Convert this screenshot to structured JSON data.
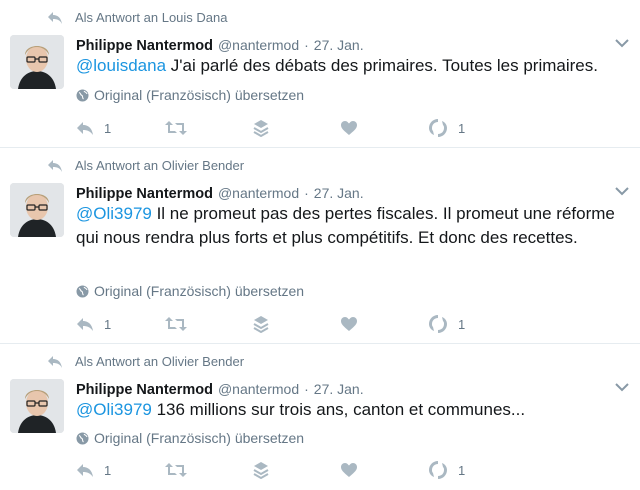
{
  "tweets": [
    {
      "context": "Als Antwort an Louis Dana",
      "fullname": "Philippe Nantermod",
      "username": "@nantermod",
      "separator": "·",
      "time": "27. Jan.",
      "mention": "@louisdana",
      "text": " J'ai parlé des débats des primaires. Toutes les primaires.",
      "translate": "Original (Französisch) übersetzen",
      "reply_count": "1",
      "sound_count": "1"
    },
    {
      "context": "Als Antwort an Olivier Bender",
      "fullname": "Philippe Nantermod",
      "username": "@nantermod",
      "separator": "·",
      "time": "27. Jan.",
      "mention": "@Oli3979",
      "text": " Il ne promeut pas des pertes fiscales. Il promeut une réforme qui nous rendra plus forts et plus compétitifs. Et donc des recettes.",
      "translate": "Original (Französisch) übersetzen",
      "reply_count": "1",
      "sound_count": "1"
    },
    {
      "context": "Als Antwort an Olivier Bender",
      "fullname": "Philippe Nantermod",
      "username": "@nantermod",
      "separator": "·",
      "time": "27. Jan.",
      "mention": "@Oli3979",
      "text": " 136 millions sur trois ans, canton et communes...",
      "translate": "Original (Französisch) übersetzen",
      "reply_count": "1",
      "sound_count": "1"
    }
  ],
  "colors": {
    "link": "#1b95e0",
    "meta": "#657786",
    "icon": "#aab8c2",
    "divider": "#e6ecf0"
  }
}
